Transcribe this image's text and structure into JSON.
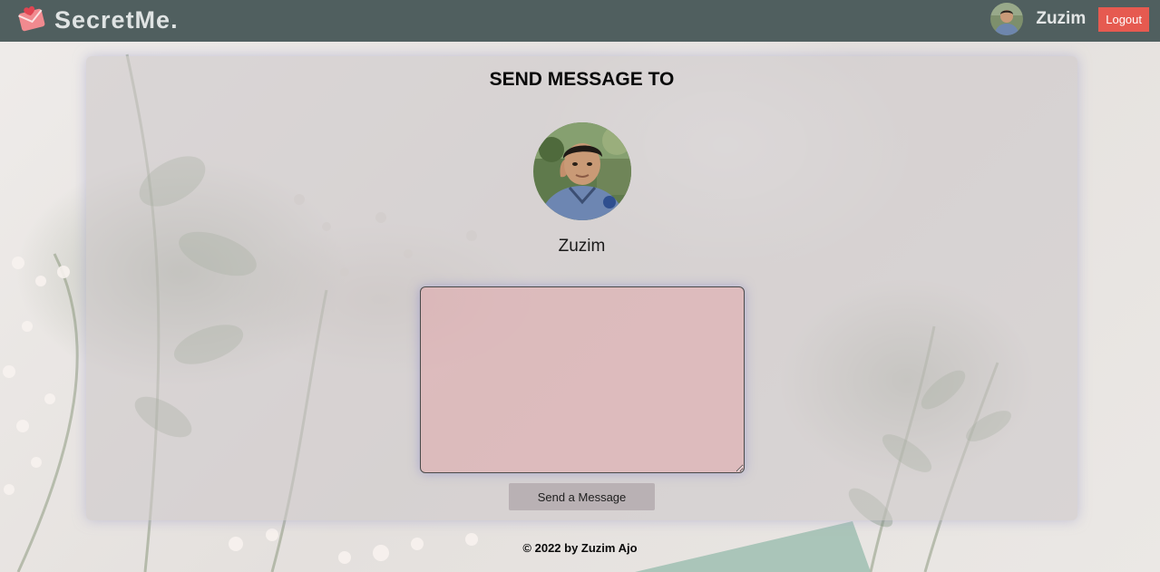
{
  "navbar": {
    "brand": "SecretMe.",
    "brand_icon": "envelope-heart-icon",
    "username": "Zuzim",
    "logout_label": "Logout"
  },
  "card": {
    "title": "SEND MESSAGE TO",
    "recipient_name": "Zuzim",
    "message_value": "",
    "send_label": "Send a Message"
  },
  "footer": {
    "text": "© 2022 by Zuzim Ajo"
  },
  "colors": {
    "navbar_bg": "#505f5f",
    "logout_bg": "#e65a50",
    "textarea_bg": "#e1a8ac"
  }
}
